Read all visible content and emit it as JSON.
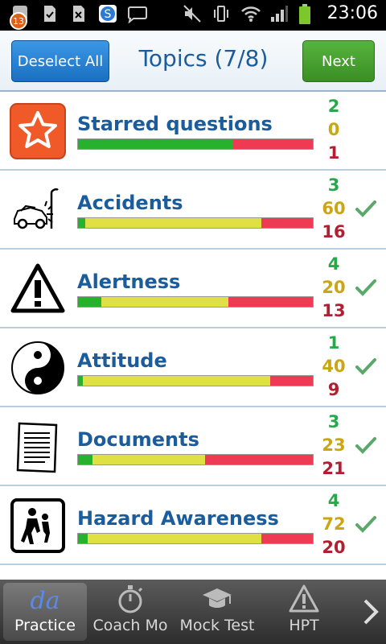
{
  "status": {
    "notification_count": "13",
    "time": "23:06"
  },
  "header": {
    "deselect_label": "Deselect All",
    "title": "Topics (7/8)",
    "next_label": "Next"
  },
  "topics": [
    {
      "name": "Starred questions",
      "green": "2",
      "yellow": "0",
      "red": "1",
      "checked": false,
      "bar": [
        0.66,
        0.0,
        0.34
      ]
    },
    {
      "name": "Accidents",
      "green": "3",
      "yellow": "60",
      "red": "16",
      "checked": true,
      "bar": [
        0.03,
        0.75,
        0.22
      ]
    },
    {
      "name": "Alertness",
      "green": "4",
      "yellow": "20",
      "red": "13",
      "checked": true,
      "bar": [
        0.1,
        0.54,
        0.36
      ]
    },
    {
      "name": "Attitude",
      "green": "1",
      "yellow": "40",
      "red": "9",
      "checked": true,
      "bar": [
        0.02,
        0.8,
        0.18
      ]
    },
    {
      "name": "Documents",
      "green": "3",
      "yellow": "23",
      "red": "21",
      "checked": true,
      "bar": [
        0.06,
        0.48,
        0.46
      ]
    },
    {
      "name": "Hazard Awareness",
      "green": "4",
      "yellow": "72",
      "red": "20",
      "checked": true,
      "bar": [
        0.04,
        0.74,
        0.22
      ]
    }
  ],
  "nav": {
    "tabs": [
      {
        "label": "Practice",
        "icon": "practice-icon"
      },
      {
        "label": "Coach Mo",
        "icon": "stopwatch-icon"
      },
      {
        "label": "Mock Test",
        "icon": "mortarboard-icon"
      },
      {
        "label": "HPT",
        "icon": "warning-icon"
      }
    ]
  }
}
